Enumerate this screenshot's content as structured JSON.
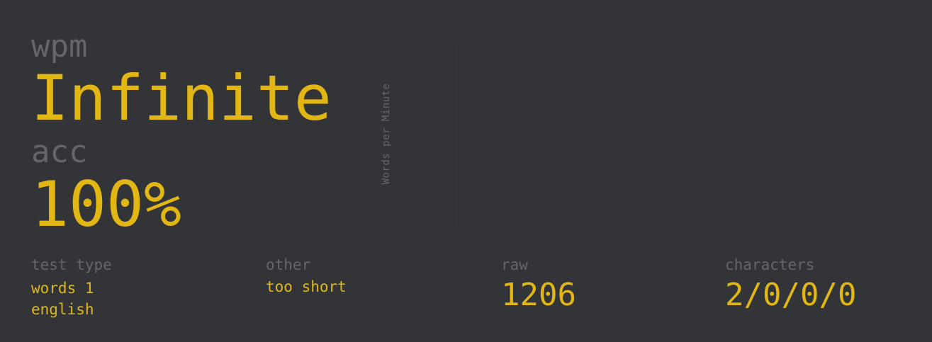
{
  "stats": {
    "wpm": {
      "label": "wpm",
      "value": "Infinite"
    },
    "acc": {
      "label": "acc",
      "value": "100%"
    }
  },
  "chart": {
    "y_axis_label": "Words per Minute"
  },
  "more_stats": {
    "test_type": {
      "label": "test type",
      "lines": [
        "words 1",
        "english"
      ]
    },
    "other": {
      "label": "other",
      "value": "too short"
    },
    "raw": {
      "label": "raw",
      "value": "1206"
    },
    "characters": {
      "label": "characters",
      "value": "2/0/0/0"
    }
  },
  "theme": {
    "background": "#323437",
    "main": "#e2b714",
    "sub": "#646669"
  }
}
